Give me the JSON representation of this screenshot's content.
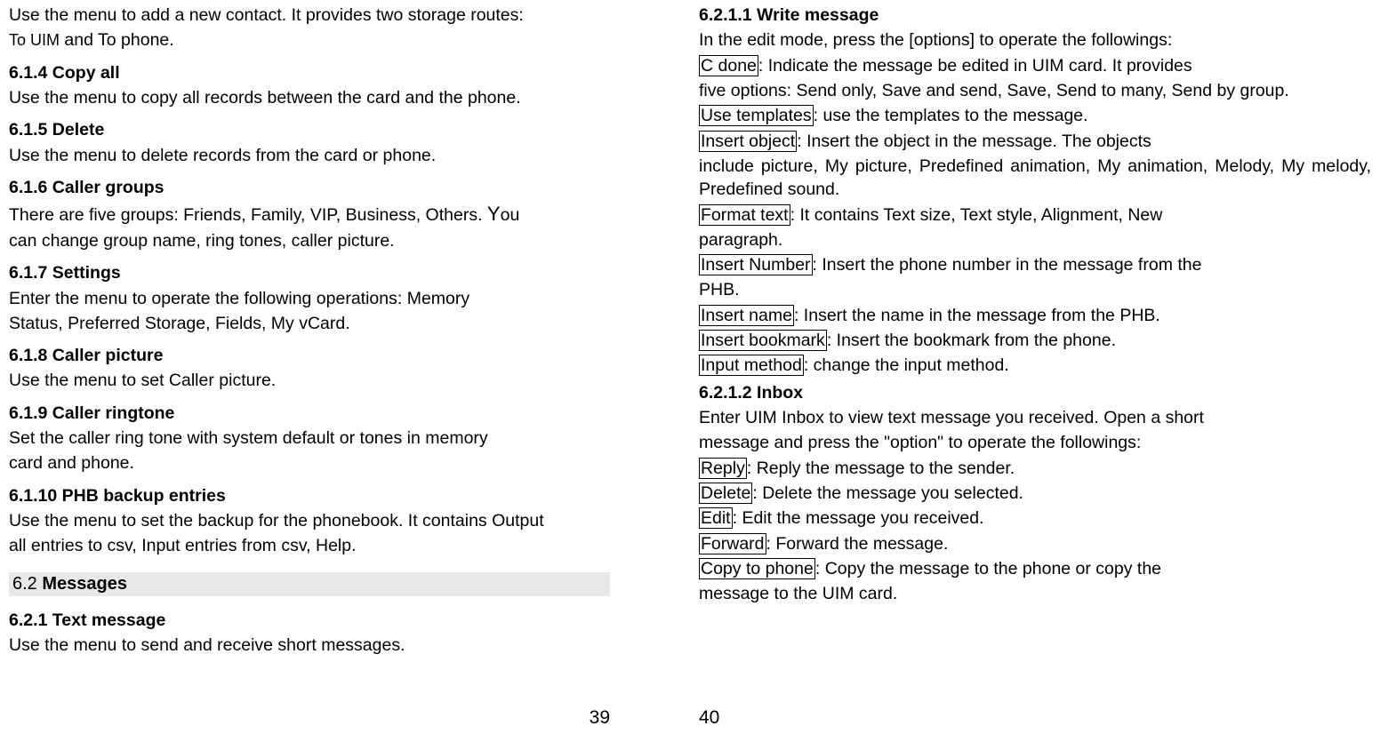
{
  "left": {
    "intro1": "Use the menu to add a new contact. It provides two storage routes:",
    "intro2a": "To UIM",
    "intro2b": " and To phone.",
    "s614h": "6.1.4 Copy all",
    "s614t": "Use the menu to copy all records between the card and the phone.",
    "s615h": "6.1.5 Delete",
    "s615t": "Use the menu to delete records from the card or phone.",
    "s616h": "6.1.6 Caller groups",
    "s616t1a": "There are five groups: Friends, Family, VIP, Business, Others.   ",
    "s616t1b": "Y",
    "s616t1c": "ou",
    "s616t2": "can change group name, ring tones, caller picture.",
    "s617h": "6.1.7 Settings",
    "s617t1": "Enter the menu to operate the following operations: Memory",
    "s617t2": "Status, Preferred Storage, Fields, My vCard.",
    "s618h": "6.1.8 Caller picture",
    "s618t": "Use the menu to set Caller picture.",
    "s619h": "6.1.9 Caller ringtone",
    "s619t1": "Set the caller ring tone with system default or tones in memory",
    "s619t2": "card and phone.",
    "s6110h": "6.1.10 PHB backup entries",
    "s6110t1": "Use the menu to set the backup for the phonebook. It contains Output",
    "s6110t2": "all entries to csv, Input entries from csv, Help.",
    "s62num": "6.2 ",
    "s62title": "Messages",
    "s621h": "6.2.1 Text message",
    "s621t": "Use the menu to send and receive short messages.",
    "pagenum": "39"
  },
  "right": {
    "s6211h": "6.2.1.1 Write message",
    "s6211t1": "In the edit mode, press the [options] to operate the followings:",
    "cdone_label": "C done",
    "cdone_t1": ": Indicate the message be edited in UIM card. It provides",
    "cdone_t2": "five options: Send only, Save and send, Save, Send to many, Send by group.",
    "usetpl_label": "Use templates",
    "usetpl_t": ": use the templates to the message.",
    "insobj_label": "Insert object",
    "insobj_t1": ": Insert the object in the message. The objects",
    "insobj_t2": "include picture, My picture, Predefined animation, My animation, Melody, My melody, Predefined sound.",
    "fmt_label": "Format text",
    "fmt_t1": ": It contains Text size, Text style, Alignment, New",
    "fmt_t2": "paragraph.",
    "insnum_label": "Insert Number",
    "insnum_t1": ": Insert the phone number in the message from the",
    "insnum_t2": "PHB.",
    "insname_label": "Insert name",
    "insname_t": ": Insert the name in the message from the PHB.",
    "insbm_label": "Insert bookmark",
    "insbm_t": ": Insert the bookmark from the phone.",
    "inmeth_label": "Input method",
    "inmeth_t": ": change the input method.",
    "s6212h": "6.2.1.2 Inbox",
    "s6212t1": "Enter UIM Inbox to view text message you received. Open a short",
    "s6212t2": "message and press the \"option\" to operate the followings:",
    "reply_label": "Reply",
    "reply_t": ": Reply the message to the sender.",
    "del_label": "Delete",
    "del_t": ": Delete the message you selected.",
    "edit_label": "Edit",
    "edit_t": ": Edit the message you received.",
    "fwd_label": "Forward",
    "fwd_t": ": Forward the message.",
    "cpy_label": "Copy to phone",
    "cpy_t1": ": Copy the message to the phone or copy the",
    "cpy_t2": "message to the UIM card.",
    "pagenum": "40"
  }
}
